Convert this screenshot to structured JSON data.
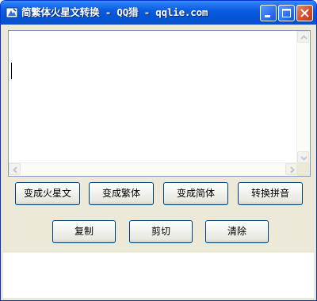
{
  "window": {
    "title": "简繁体火星文转换 - QQ猎 - qqlie.com",
    "icon": "app-icon",
    "controls": {
      "minimize": "minimize-icon",
      "maximize": "maximize-icon",
      "close": "close-icon"
    }
  },
  "editor": {
    "value": ""
  },
  "buttons_row1": [
    {
      "label": "变成火星文"
    },
    {
      "label": "变成繁体"
    },
    {
      "label": "变成简体"
    },
    {
      "label": "转换拼音"
    }
  ],
  "buttons_row2": [
    {
      "label": "复制"
    },
    {
      "label": "剪切"
    },
    {
      "label": "清除"
    }
  ],
  "colors": {
    "titlebar": "#0554d8",
    "window_bg": "#ece9d8",
    "button_border": "#003c74",
    "close_button": "#d44a26"
  }
}
